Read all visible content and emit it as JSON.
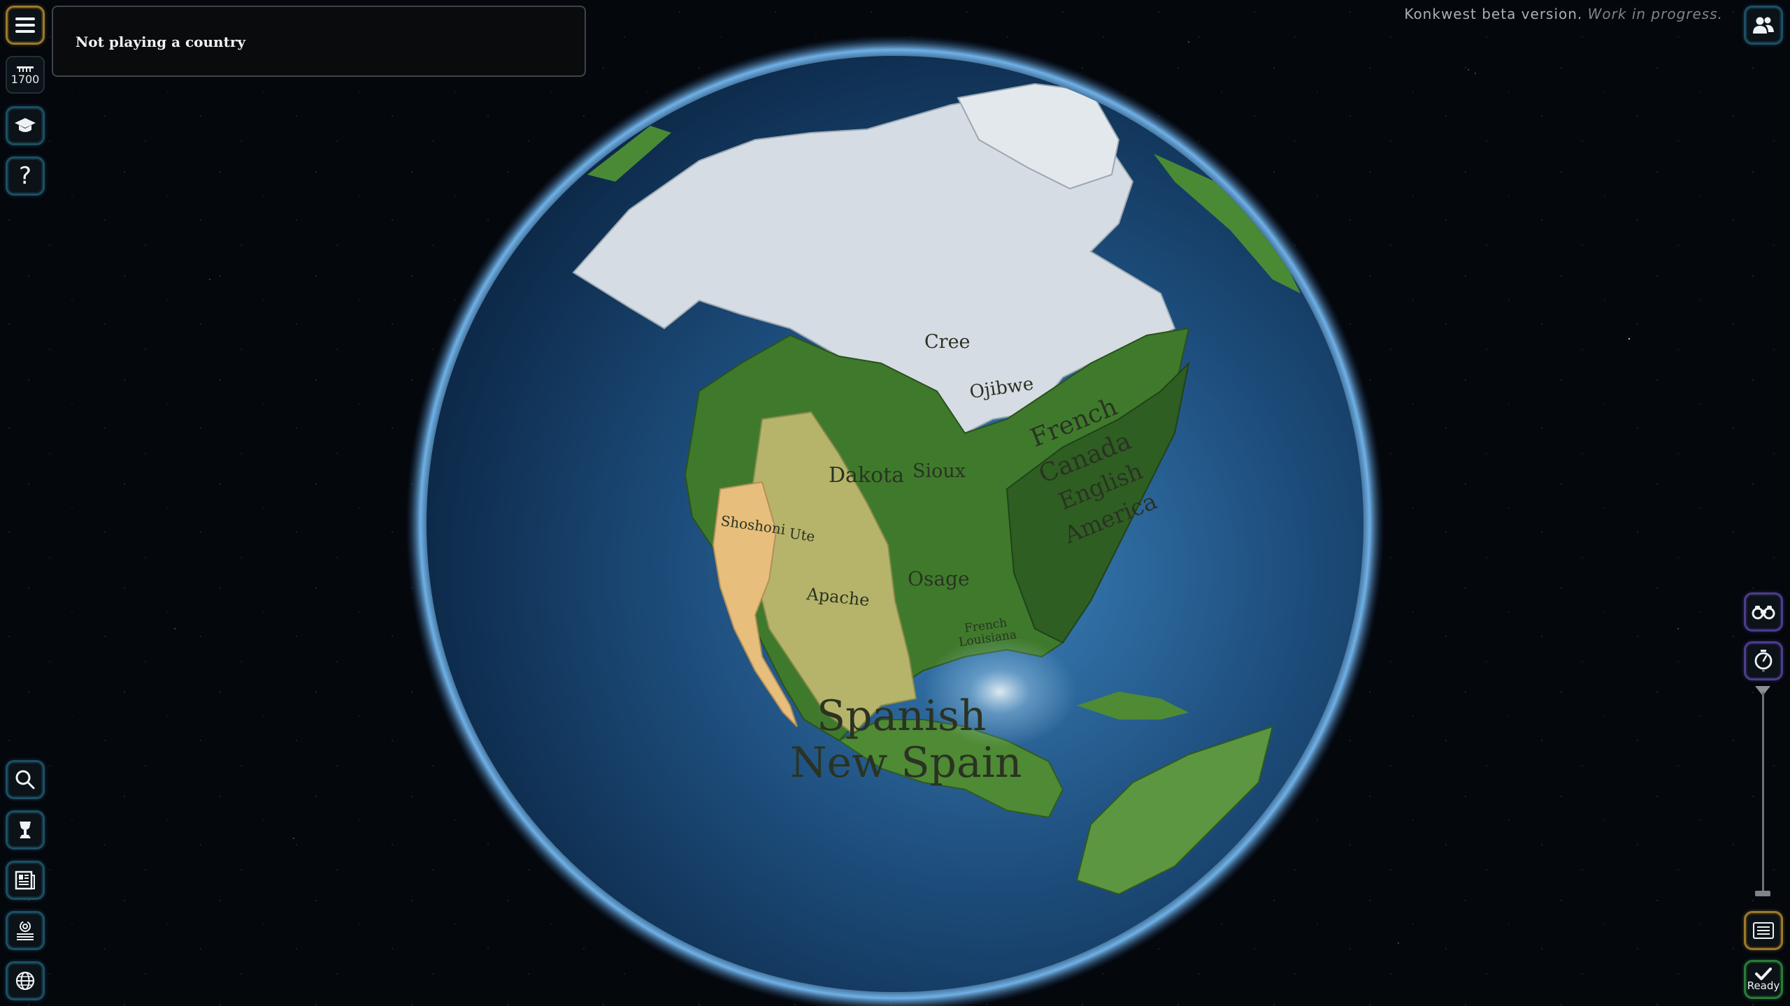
{
  "header": {
    "status_text": "Not playing a country",
    "beta_title": "Konkwest beta version.",
    "beta_note": "Work in progress."
  },
  "year": {
    "value": "1700"
  },
  "left_toolbar": {
    "top": [
      "menu-icon",
      "academy-icon",
      "help-icon"
    ],
    "help_glyph": "?",
    "bottom": [
      "search-icon",
      "trophy-icon",
      "news-icon",
      "fingerprint-icon",
      "globe-icon"
    ]
  },
  "right_toolbar": {
    "top": [
      "players-icon"
    ],
    "middle": [
      "binoculars-icon",
      "timer-icon"
    ],
    "bottom": [
      "list-icon",
      "ready-icon"
    ],
    "ready_label": "Ready"
  },
  "map": {
    "labels": {
      "cree": "Cree",
      "ojibwe": "Ojibwe",
      "dakota": "Dakota",
      "sioux": "Sioux",
      "french_1": "French",
      "french_2": "Canada",
      "english_1": "English",
      "english_2": "America",
      "shoshoni": "Shoshoni",
      "ute": "Ute",
      "apache": "Apache",
      "osage": "Osage",
      "french_louisiana_1": "French",
      "french_louisiana_2": "Louisiana",
      "spanish_1": "Spanish",
      "spanish_2": "New Spain"
    },
    "colors": {
      "ocean": "#1f4f80",
      "ice": "#d6dde4",
      "forest": "#3f7a2c",
      "dark_forest": "#2e5e22",
      "plains": "#b6b46a",
      "desert": "#e7be7c",
      "atmosphere": "#6fb7ff"
    }
  }
}
